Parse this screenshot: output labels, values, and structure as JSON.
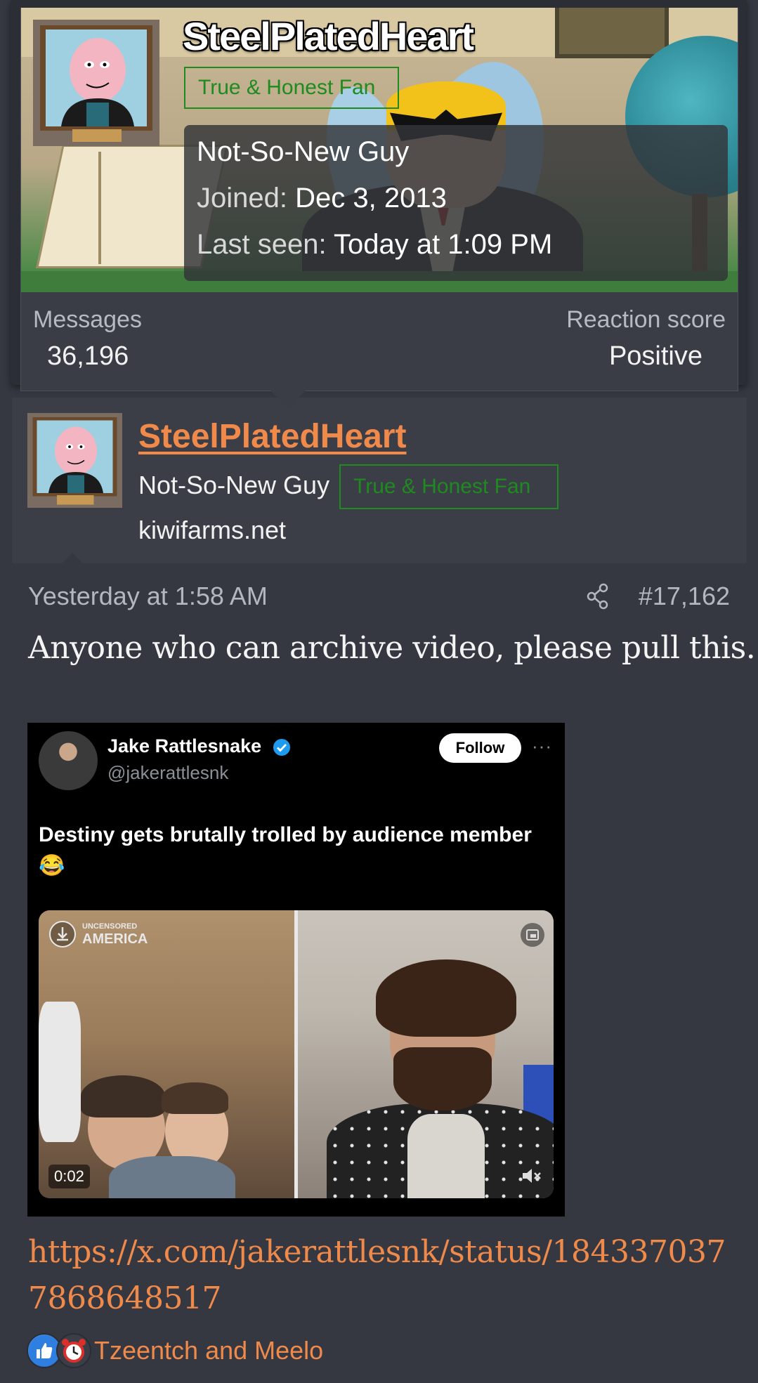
{
  "member_card": {
    "username": "SteelPlatedHeart",
    "badge": "True & Honest Fan",
    "user_title": "Not-So-New Guy",
    "joined_label": "Joined:",
    "joined_value": "Dec 3, 2013",
    "last_seen_label": "Last seen:",
    "last_seen_value": "Today at 1:09 PM",
    "messages_label": "Messages",
    "messages_value": "36,196",
    "reaction_score_label": "Reaction score",
    "reaction_score_value": "Positive"
  },
  "post": {
    "username": "SteelPlatedHeart",
    "user_title": "Not-So-New Guy",
    "badge": "True & Honest Fan",
    "site": "kiwifarms.net",
    "date": "Yesterday at 1:58 AM",
    "number": "#17,162",
    "body": "Anyone who can archive video, please pull this.",
    "link": "https://x.com/jakerattlesnk/status/1843370377868648517",
    "reactions": {
      "icons": [
        "like-icon",
        "alarm-clock-icon"
      ],
      "names": "Tzeentch and Meelo"
    }
  },
  "embed": {
    "display_name": "Jake Rattlesnake",
    "handle": "@jakerattlesnk",
    "follow_label": "Follow",
    "more_label": "···",
    "text": "Destiny gets brutally trolled by audience member 😂",
    "video_logo_line1": "UNCENSORED",
    "video_logo_line2": "AMERICA",
    "video_time": "0:02"
  },
  "colors": {
    "background": "#353841",
    "accent_link": "#f08a4b",
    "badge_green": "#1f8a1f"
  }
}
